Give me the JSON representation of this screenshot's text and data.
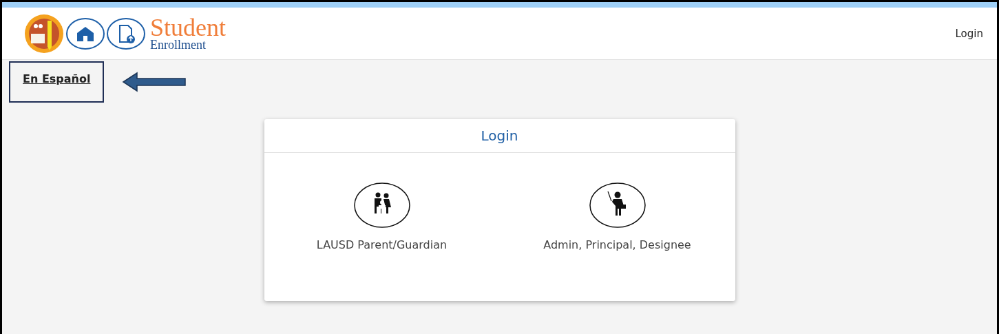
{
  "header": {
    "logo_title": "Student",
    "logo_subtitle": "Enrollment",
    "login_link": "Login"
  },
  "language_link": "En Español",
  "login_card": {
    "title": "Login",
    "options": [
      {
        "kind": "family",
        "label": "LAUSD Parent/Guardian"
      },
      {
        "kind": "teacher",
        "label": "Admin, Principal, Designee"
      }
    ]
  }
}
